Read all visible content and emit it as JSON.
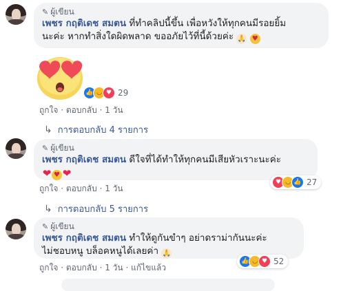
{
  "colors": {
    "name": "#385898",
    "meta": "#606770",
    "bubble": "#f2f3f5",
    "like": "#1877f2",
    "love": "#f33e58",
    "haha": "#f7b928"
  },
  "comments": [
    {
      "badge": "ผู้เขียน",
      "author": "เพชร กฤติเดช สมตน",
      "lines": [
        "ที่ทำคลิปนี้ขึ้น เพื่อหวังให้ทุกคนมีรอยยิ้ม",
        "นะค่ะ หากทำสิ่งใดผิดพลาด ขออภัยไว้ที่นี้ด้วยค่ะ"
      ],
      "trailing_icons": [
        "pray-icon",
        "love-face-icon"
      ],
      "sticker": "heart-eyes-face-sticker",
      "reaction_icons": [
        "like-icon",
        "haha-icon",
        "love-icon"
      ],
      "reaction_count": "29",
      "actions": {
        "like": "ถูกใจ",
        "reply": "ตอบกลับ",
        "time": "1 วัน",
        "edited": ""
      },
      "replies_label": "การตอบกลับ 4 รายการ"
    },
    {
      "badge": "ผู้เขียน",
      "author": "เพชร กฤติเดช สมตน",
      "lines": [
        "ดีใจที่ได้ทำให้ทุกคนมีเสียหัวเราะนะค่ะ"
      ],
      "trailing_icons": [
        "heart-icon",
        "love-face-icon",
        "heart-icon"
      ],
      "reaction_icons": [
        "love-icon",
        "haha-icon",
        "like-icon"
      ],
      "reaction_count": "27",
      "actions": {
        "like": "ถูกใจ",
        "reply": "ตอบกลับ",
        "time": "1 วัน",
        "edited": ""
      },
      "replies_label": "การตอบกลับ 5 รายการ"
    },
    {
      "badge": "ผู้เขียน",
      "author": "เพชร กฤติเดช สมตน",
      "lines": [
        "ทำให้ดูกันขำๆ อย่าดราม่ากันนะค่ะ",
        "ไม่ชอบหนู บล็อคหนูได้เลยค่า"
      ],
      "trailing_icons": [
        "pray-icon"
      ],
      "reaction_icons": [
        "like-icon",
        "haha-icon",
        "love-icon"
      ],
      "reaction_count": "52",
      "actions": {
        "like": "ถูกใจ",
        "reply": "ตอบกลับ",
        "time": "1 วัน",
        "edited": "แก้ไขแล้ว"
      }
    }
  ]
}
